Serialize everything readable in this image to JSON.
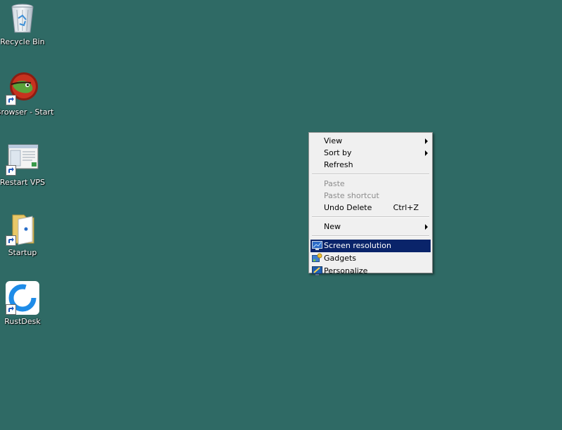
{
  "desktop": {
    "background_color": "#2f6a65",
    "icons": [
      {
        "label": "Recycle Bin",
        "icon": "recycle-bin-icon",
        "shortcut": false
      },
      {
        "label": "Browser - Start",
        "icon": "browser-icon",
        "shortcut": true
      },
      {
        "label": "Restart VPS",
        "icon": "restart-vps-icon",
        "shortcut": true
      },
      {
        "label": "Startup",
        "icon": "folder-icon",
        "shortcut": true
      },
      {
        "label": "RustDesk",
        "icon": "rustdesk-icon",
        "shortcut": true
      }
    ]
  },
  "context_menu": {
    "highlight_color": "#0a246a",
    "view": "View",
    "sort_by": "Sort by",
    "refresh": "Refresh",
    "paste": "Paste",
    "paste_shortcut": "Paste shortcut",
    "undo_delete": "Undo Delete",
    "undo_delete_shortcut": "Ctrl+Z",
    "new": "New",
    "screen_resolution": "Screen resolution",
    "gadgets": "Gadgets",
    "personalize": "Personalize"
  }
}
